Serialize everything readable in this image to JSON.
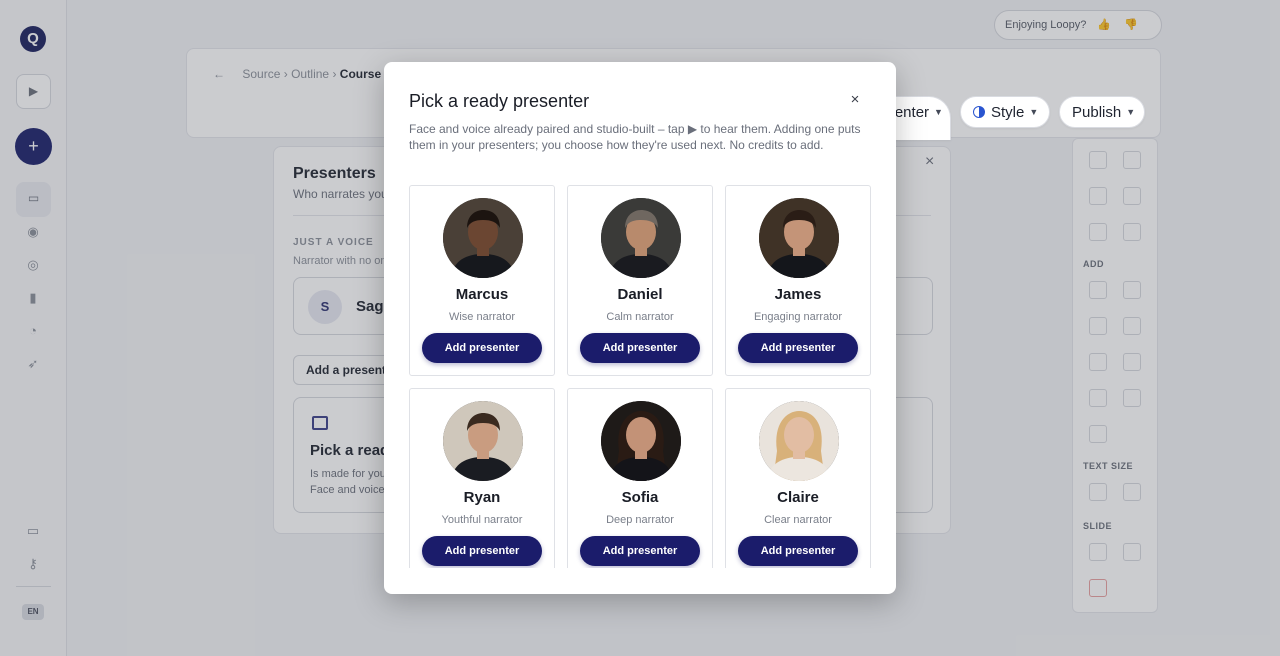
{
  "background": {
    "logo": "Q",
    "rail_icons": [
      "panel-toggle-icon",
      "plus-icon",
      "folder-icon",
      "pin-icon",
      "eye-icon",
      "mic-icon",
      "clock-icon",
      "rocket-icon",
      "card-icon",
      "key-icon"
    ],
    "language": "EN",
    "breadcrumb": [
      "Source",
      "Outline",
      "Course"
    ],
    "feedback_text": "Enjoying Loopy?",
    "panel": {
      "title": "Presenters",
      "subtitle": "Who narrates your course",
      "section_label": "JUST A VOICE",
      "section_sub": "Narrator with no on-screen face",
      "voice_initial": "S",
      "voice_name": "Sage",
      "add_button": "Add a presenter",
      "ready_title": "Pick a ready presenter",
      "ready_desc_1": "Is made for you",
      "ready_desc_2": "Face and voice"
    },
    "rightbar": {
      "add_label": "ADD",
      "text_size_label": "TEXT SIZE",
      "slide_label": "SLIDE"
    }
  },
  "toolbar": {
    "presenter": "Presenter",
    "style": "Style",
    "publish": "Publish"
  },
  "modal": {
    "title": "Pick a ready presenter",
    "description": "Face and voice already paired and studio-built – tap ▶ to hear them. Adding one puts them in your presenters; you choose how they're used next. No credits to add.",
    "close_symbol": "×"
  },
  "presenters": [
    {
      "name": "Marcus",
      "role": "Wise narrator",
      "button": "Add presenter",
      "skin": "#6b4632",
      "hair": "#1c1410",
      "shirt": "#16181d",
      "bg": "#4a4037"
    },
    {
      "name": "Daniel",
      "role": "Calm narrator",
      "button": "Add presenter",
      "skin": "#b88a6c",
      "hair": "#6f6760",
      "shirt": "#1a1b20",
      "bg": "#3a3a38"
    },
    {
      "name": "James",
      "role": "Engaging narrator",
      "button": "Add presenter",
      "skin": "#c49478",
      "hair": "#2a1d16",
      "shirt": "#14161b",
      "bg": "#3f3226"
    },
    {
      "name": "Ryan",
      "role": "Youthful narrator",
      "button": "Add presenter",
      "skin": "#c99c80",
      "hair": "#3a2a1f",
      "shirt": "#1a1c22",
      "bg": "#cfc7bb"
    },
    {
      "name": "Sofia",
      "role": "Deep narrator",
      "button": "Add presenter",
      "skin": "#c39277",
      "hair": "#2a1b14",
      "shirt": "#141419",
      "bg": "#1e1a18"
    },
    {
      "name": "Claire",
      "role": "Clear narrator",
      "button": "Add presenter",
      "skin": "#e2bda3",
      "hair": "#d8b17a",
      "shirt": "#ece6df",
      "bg": "#e9e3dc"
    }
  ]
}
